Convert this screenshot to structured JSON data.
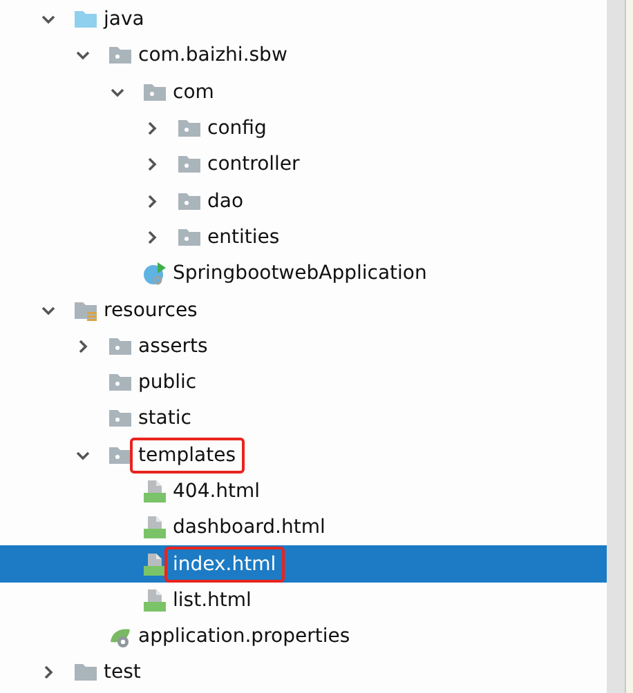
{
  "tree": [
    {
      "label": "java",
      "kind": "source-folder",
      "expanded": true,
      "selected": false,
      "highlighted": false,
      "children": [
        {
          "label": "com.baizhi.sbw",
          "kind": "package",
          "expanded": true,
          "selected": false,
          "highlighted": false,
          "children": [
            {
              "label": "com",
              "kind": "package",
              "expanded": true,
              "selected": false,
              "highlighted": false,
              "children": [
                {
                  "label": "config",
                  "kind": "package",
                  "expanded": false,
                  "selected": false,
                  "highlighted": false
                },
                {
                  "label": "controller",
                  "kind": "package",
                  "expanded": false,
                  "selected": false,
                  "highlighted": false
                },
                {
                  "label": "dao",
                  "kind": "package",
                  "expanded": false,
                  "selected": false,
                  "highlighted": false
                },
                {
                  "label": "entities",
                  "kind": "package",
                  "expanded": false,
                  "selected": false,
                  "highlighted": false
                }
              ]
            },
            {
              "label": "SpringbootwebApplication",
              "kind": "spring-class",
              "selected": false,
              "highlighted": false
            }
          ]
        }
      ]
    },
    {
      "label": "resources",
      "kind": "resources-folder",
      "expanded": true,
      "selected": false,
      "highlighted": false,
      "children": [
        {
          "label": "asserts",
          "kind": "package",
          "expanded": false,
          "selected": false,
          "highlighted": false
        },
        {
          "label": "public",
          "kind": "package",
          "selected": false,
          "highlighted": false
        },
        {
          "label": "static",
          "kind": "package",
          "selected": false,
          "highlighted": false
        },
        {
          "label": "templates",
          "kind": "package",
          "expanded": true,
          "selected": false,
          "highlighted": true,
          "children": [
            {
              "label": "404.html",
              "kind": "html",
              "selected": false,
              "highlighted": false
            },
            {
              "label": "dashboard.html",
              "kind": "html",
              "selected": false,
              "highlighted": false
            },
            {
              "label": "index.html",
              "kind": "html",
              "selected": true,
              "highlighted": true
            },
            {
              "label": "list.html",
              "kind": "html",
              "selected": false,
              "highlighted": false
            }
          ]
        },
        {
          "label": "application.properties",
          "kind": "properties",
          "selected": false,
          "highlighted": false
        }
      ]
    },
    {
      "label": "test",
      "kind": "folder",
      "expanded": false,
      "selected": false,
      "highlighted": false
    }
  ]
}
